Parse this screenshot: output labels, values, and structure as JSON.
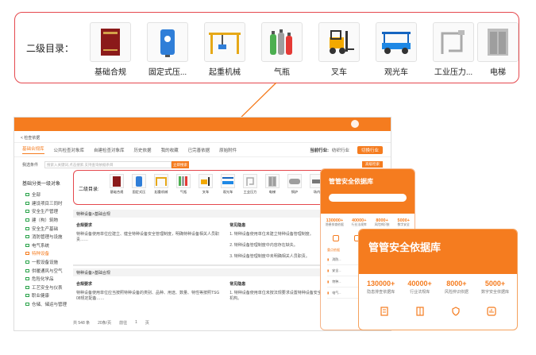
{
  "callout": {
    "label": "二级目录：",
    "categories": [
      {
        "name": "基础合规",
        "icon": "book-icon"
      },
      {
        "name": "固定式压...",
        "icon": "pressure-vessel-icon"
      },
      {
        "name": "起重机械",
        "icon": "crane-icon"
      },
      {
        "name": "气瓶",
        "icon": "gas-cylinder-icon"
      },
      {
        "name": "叉车",
        "icon": "forklift-icon"
      },
      {
        "name": "观光车",
        "icon": "sightseeing-car-icon"
      },
      {
        "name": "工业压力...",
        "icon": "pipeline-icon"
      },
      {
        "name": "电梯",
        "icon": "elevator-icon"
      }
    ]
  },
  "shot": {
    "subbar": "< 检查依据",
    "tabs": [
      "基础合规库",
      "公共检查对象库",
      "自建检查对象库",
      "历史依据",
      "我的收藏",
      "已完善依据",
      "原始附件"
    ],
    "industry_label": "当前行业:",
    "industry_value": "纺织行业",
    "switch_label": "切换行业",
    "search_label": "我选条件",
    "search_placeholder": "搜索入关键词,点击搜索,支持查询依据条目",
    "search_button": "立即搜索",
    "advanced_button": "高级检索",
    "sidebar_head": "基础分类一级对象",
    "sidebar_items": [
      "全部",
      "建设项目三同时",
      "安全生产管理",
      "建（构）筑物",
      "安全生产基础",
      "消防管理与设施",
      "电气系统",
      "特种设备",
      "一般设备设施",
      "供暖通风与空气",
      "危险化学品",
      "工艺安全与仪表",
      "职业健康",
      "仓储、储运与管理"
    ],
    "sidebar_active_index": 7,
    "mini_label": "二级目录:",
    "mini_items": [
      "基础合规",
      "固定式压",
      "起重机械",
      "气瓶",
      "叉车",
      "观光车",
      "工业压力",
      "电梯",
      "锅炉",
      "场内"
    ],
    "section1": "特种设备>基础合规",
    "col1": "合规要求",
    "col2": "常见隐患",
    "row1a": "特种设备使用单位应建立、健全特种设备安全管理制度，明确特种设备相关人员职责……",
    "row1b": "1. 特种设备使用单位未建立特种设备管理制度。",
    "row2b": "2. 特种设备管理制度中内容存在缺失。",
    "row3b": "3. 特种设备管理制度中未明确相关人员职责。",
    "section2": "特种设备>基础合规",
    "row4a": "特种设备使用单位应当按照特种设备的类别、品种、用途、数量、特性等按照TSG 08规定配备……",
    "row4b": "1. 特种设备使用单位未按法规要求设置特种设备安全管理机构。",
    "pager_total": "共 548 条",
    "pager_size": "20条/页",
    "pager_goto": "前往",
    "pager_page": "1",
    "pager_unit": "页"
  },
  "mcard": {
    "title": "管管安全依据库",
    "stats": [
      {
        "v": "130000+",
        "l": "隐患排查依据"
      },
      {
        "v": "40000+",
        "l": "行业法规库"
      },
      {
        "v": "8000+",
        "l": "风险辨识依"
      },
      {
        "v": "5000+",
        "l": "数字安全"
      }
    ],
    "list_head": "重点依据",
    "list": [
      "消防...",
      "安全...",
      "特种...",
      "电气..."
    ]
  },
  "bcard": {
    "title": "管管安全依据库",
    "stats": [
      {
        "v": "130000+",
        "l": "隐患排查依据库"
      },
      {
        "v": "40000+",
        "l": "行业法规库"
      },
      {
        "v": "8000+",
        "l": "风险辨识依据"
      },
      {
        "v": "5000+",
        "l": "数字安全依据库"
      }
    ]
  },
  "colors": {
    "accent": "#f57c1f",
    "highlight": "#e5484d"
  }
}
